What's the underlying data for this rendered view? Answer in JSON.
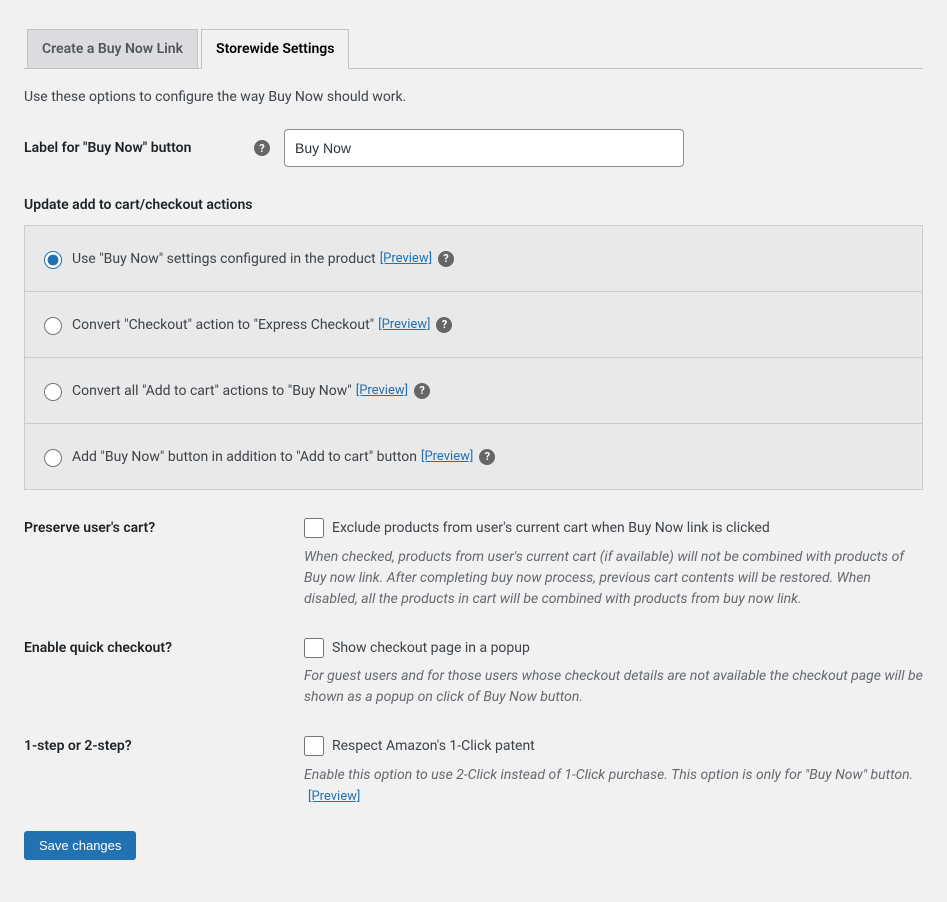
{
  "tabs": {
    "create": "Create a Buy Now Link",
    "storewide": "Storewide Settings"
  },
  "intro": "Use these options to configure the way Buy Now should work.",
  "label_field": {
    "label": "Label for \"Buy Now\" button",
    "value": "Buy Now"
  },
  "update_actions": {
    "heading": "Update add to cart/checkout actions",
    "options": [
      {
        "text": "Use \"Buy Now\" settings configured in the product",
        "preview": "[Preview]"
      },
      {
        "text": "Convert \"Checkout\" action to \"Express Checkout\"",
        "preview": "[Preview]"
      },
      {
        "text": "Convert all \"Add to cart\" actions to \"Buy Now\"",
        "preview": "[Preview]"
      },
      {
        "text": "Add \"Buy Now\" button in addition to \"Add to cart\" button",
        "preview": "[Preview]"
      }
    ]
  },
  "preserve_cart": {
    "label": "Preserve user's cart?",
    "checkbox": "Exclude products from user's current cart when Buy Now link is clicked",
    "desc": "When checked, products from user's current cart (if available) will not be combined with products of Buy now link. After completing buy now process, previous cart contents will be restored. When disabled, all the products in cart will be combined with products from buy now link."
  },
  "quick_checkout": {
    "label": "Enable quick checkout?",
    "checkbox": "Show checkout page in a popup",
    "desc": "For guest users and for those users whose checkout details are not available the checkout page will be shown as a popup on click of Buy Now button."
  },
  "one_step": {
    "label": "1-step or 2-step?",
    "checkbox": "Respect Amazon's 1-Click patent",
    "desc": "Enable this option to use 2-Click instead of 1-Click purchase. This option is only for \"Buy Now\" button. ",
    "preview": "[Preview]"
  },
  "save": "Save changes"
}
